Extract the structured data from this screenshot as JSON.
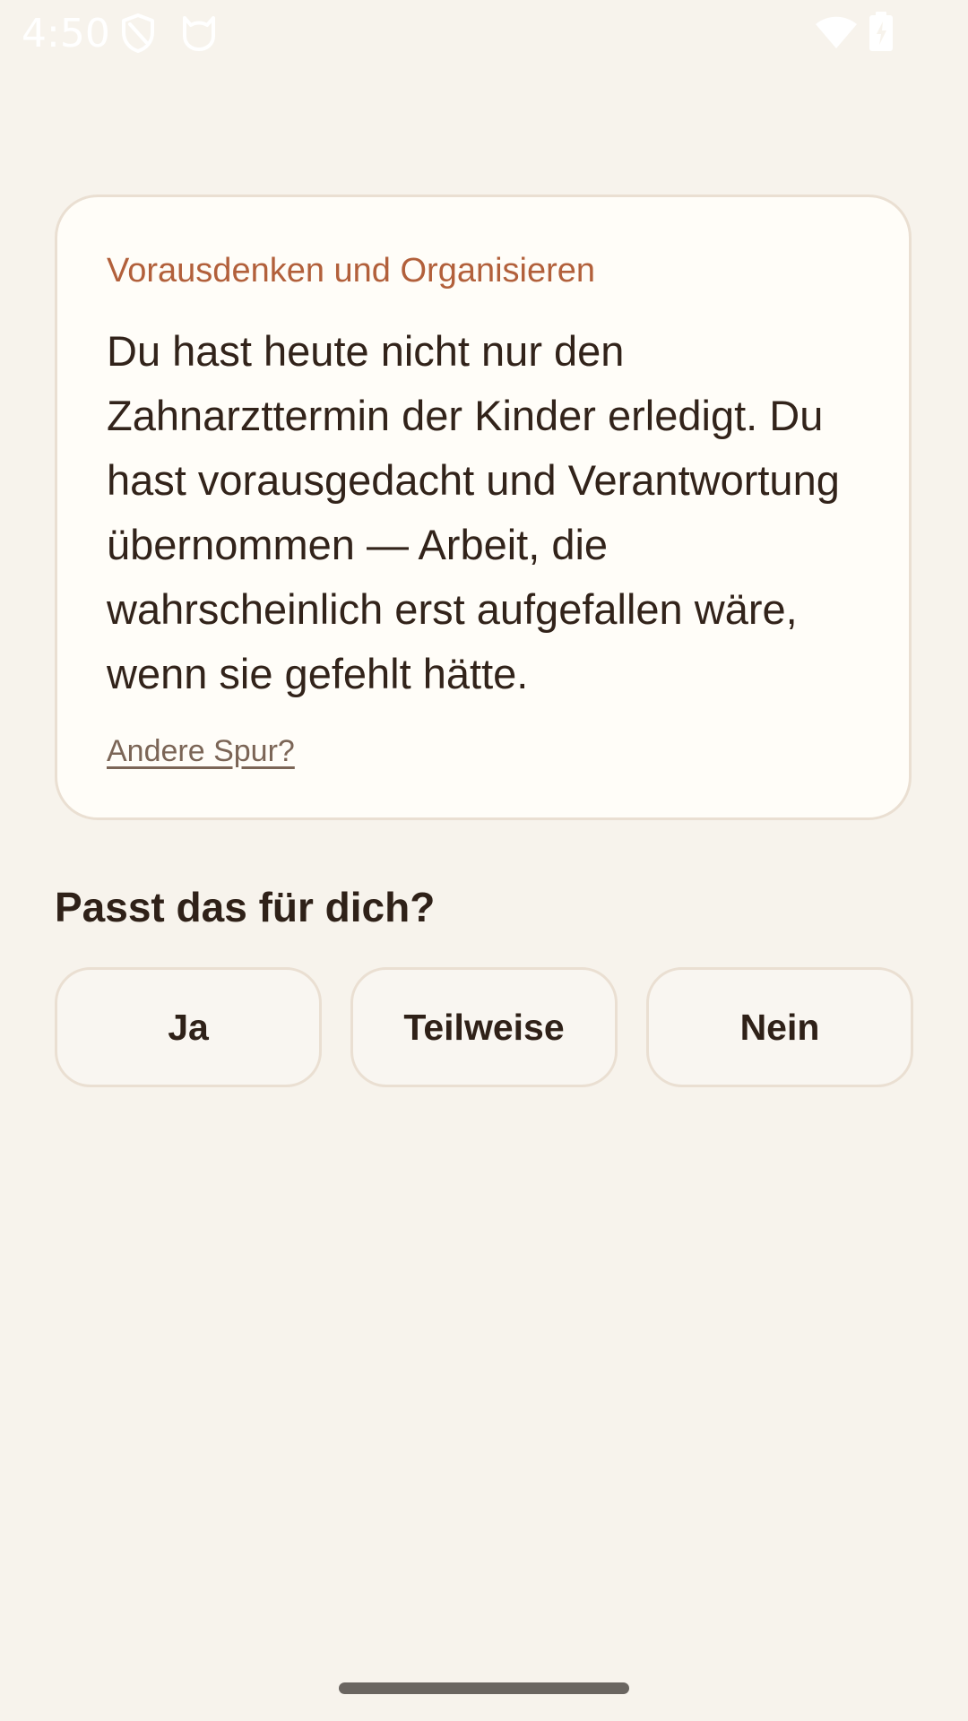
{
  "status_bar": {
    "time": "4:50",
    "left_icons": [
      "shield-icon",
      "cat-face-icon"
    ],
    "right_icons": [
      "wifi-icon",
      "battery-charging-icon"
    ]
  },
  "card": {
    "label": "Vorausdenken und Organisieren",
    "body": "Du hast heute nicht nur den Zahnarzttermin der Kinder erledigt. Du hast vorausgedacht und Verantwortung übernommen — Arbeit, die wahrscheinlich erst aufgefallen wäre, wenn sie gefehlt hätte.",
    "link": "Andere Spur?"
  },
  "question": "Passt das für dich?",
  "answers": [
    "Ja",
    "Teilweise",
    "Nein"
  ],
  "colors": {
    "background": "#f7f3ec",
    "card_background": "#fffdf8",
    "accent": "#b2603b",
    "text": "#2f2118",
    "border": "#eadfd2"
  }
}
